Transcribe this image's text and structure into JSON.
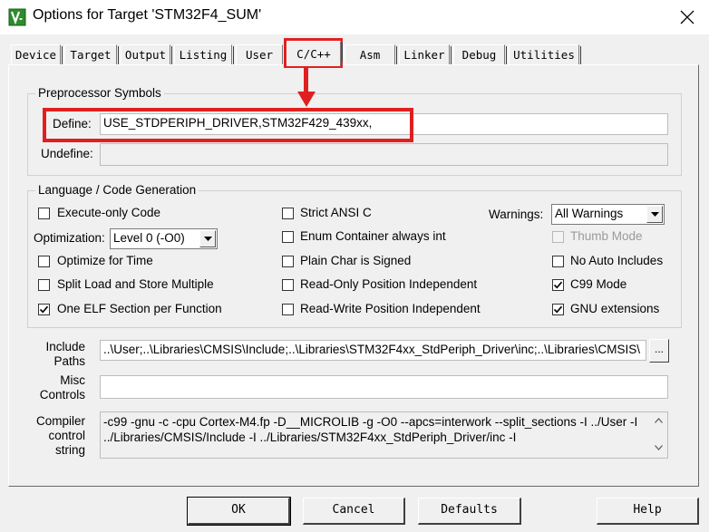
{
  "window": {
    "title": "Options for Target 'STM32F4_SUM'",
    "app_icon": "keil-uvision-icon",
    "close_icon": "close-icon"
  },
  "tabs": [
    {
      "label": "Device"
    },
    {
      "label": "Target"
    },
    {
      "label": "Output"
    },
    {
      "label": "Listing"
    },
    {
      "label": "User"
    },
    {
      "label": "C/C++",
      "active": true
    },
    {
      "label": "Asm"
    },
    {
      "label": "Linker"
    },
    {
      "label": "Debug"
    },
    {
      "label": "Utilities"
    }
  ],
  "preprocessor": {
    "title": "Preprocessor Symbols",
    "define_label": "Define:",
    "define_value": "USE_STDPERIPH_DRIVER,STM32F429_439xx,",
    "undefine_label": "Undefine:",
    "undefine_value": ""
  },
  "codegen": {
    "title": "Language / Code Generation",
    "execute_only": {
      "label": "Execute-only Code",
      "checked": false
    },
    "optimization_label": "Optimization:",
    "optimization_value": "Level 0 (-O0)",
    "optimize_time": {
      "label": "Optimize for Time",
      "checked": false
    },
    "split_load": {
      "label": "Split Load and Store Multiple",
      "checked": false
    },
    "one_elf": {
      "label": "One ELF Section per Function",
      "checked": true
    },
    "strict_ansi": {
      "label": "Strict ANSI C",
      "checked": false
    },
    "enum_int": {
      "label": "Enum Container always int",
      "checked": false
    },
    "plain_char": {
      "label": "Plain Char is Signed",
      "checked": false
    },
    "ropi": {
      "label": "Read-Only Position Independent",
      "checked": false
    },
    "rwpi": {
      "label": "Read-Write Position Independent",
      "checked": false
    },
    "warnings_label": "Warnings:",
    "warnings_value": "All Warnings",
    "thumb_mode": {
      "label": "Thumb Mode",
      "checked": false,
      "disabled": true
    },
    "no_auto_includes": {
      "label": "No Auto Includes",
      "checked": false
    },
    "c99_mode": {
      "label": "C99 Mode",
      "checked": true
    },
    "gnu_ext": {
      "label": "GNU extensions",
      "checked": true
    }
  },
  "include_paths": {
    "label_line1": "Include",
    "label_line2": "Paths",
    "value": "..\\User;..\\Libraries\\CMSIS\\Include;..\\Libraries\\STM32F4xx_StdPeriph_Driver\\inc;..\\Libraries\\CMSIS\\",
    "browse_label": "..."
  },
  "misc": {
    "label_line1": "Misc",
    "label_line2": "Controls",
    "value": ""
  },
  "compiler": {
    "label_line1": "Compiler",
    "label_line2": "control",
    "label_line3": "string",
    "line1": "-c99 -gnu -c -cpu Cortex-M4.fp -D__MICROLIB -g -O0 --apcs=interwork --split_sections -I ../User -I",
    "line2": "../Libraries/CMSIS/Include -I ../Libraries/STM32F4xx_StdPeriph_Driver/inc -I"
  },
  "buttons": {
    "ok": "OK",
    "cancel": "Cancel",
    "defaults": "Defaults",
    "help": "Help"
  },
  "annotation_color": "#e02020"
}
